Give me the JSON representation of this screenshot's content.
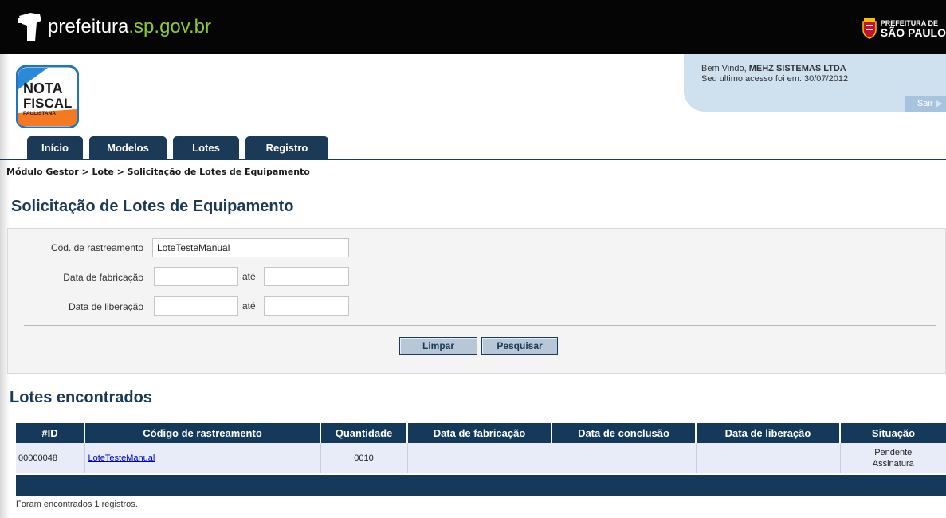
{
  "header": {
    "site_name_prefix": "prefeitura",
    "site_name_domain": ".sp.gov.br",
    "pref_line1": "PREFEITURA DE",
    "pref_line2": "SÃO PAULO",
    "logo_line1": "NOTA",
    "logo_line2": "FISCAL",
    "logo_line3": "PAULISTANA"
  },
  "welcome": {
    "greeting": "Bem Vindo, ",
    "user": "MEHZ SISTEMAS LTDA",
    "last_access": "Seu ultimo acesso foi em: 30/07/2012",
    "logout_label": "Sair"
  },
  "tabs": [
    {
      "label": "Início"
    },
    {
      "label": "Modelos"
    },
    {
      "label": "Lotes"
    },
    {
      "label": "Registro"
    }
  ],
  "breadcrumb": "Módulo Gestor > Lote > Solicitação de Lotes de Equipamento",
  "page_title": "Solicitação de Lotes de Equipamento",
  "form": {
    "tracking_label": "Cód. de rastreamento",
    "tracking_value": "LoteTesteManual",
    "fabrication_label": "Data de fabricação",
    "release_label": "Data de liberação",
    "ate_label": "até",
    "clear_button": "Limpar",
    "search_button": "Pesquisar"
  },
  "results": {
    "title": "Lotes encontrados",
    "columns": [
      "#ID",
      "Código de rastreamento",
      "Quantidade",
      "Data de fabricação",
      "Data de conclusão",
      "Data de liberação",
      "Situação"
    ],
    "rows": [
      {
        "id": "00000048",
        "code": "LoteTesteManual",
        "quantity": "0010",
        "fabrication": "",
        "conclusion": "",
        "release": "",
        "status_line1": "Pendente",
        "status_line2": "Assinatura"
      }
    ],
    "count_text": "Foram encontrados 1 registros."
  },
  "colors": {
    "topbar": "#050505",
    "navy": "#15395a",
    "accent_green": "#8cc63f",
    "welcome_bg": "#cfe0ef",
    "row_bg": "#e8ecf8"
  }
}
